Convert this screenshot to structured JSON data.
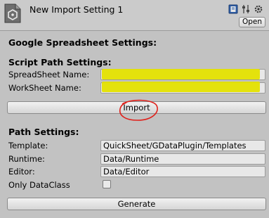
{
  "header": {
    "title": "New Import Setting 1",
    "open_label": "Open",
    "icons": [
      "help-book-icon",
      "settings-sliders-icon",
      "gear-icon"
    ]
  },
  "google_section": {
    "title": "Google Spreadsheet Settings:"
  },
  "script_path": {
    "title": "Script Path Settings:",
    "spreadsheet_label": "SpreadSheet Name:",
    "spreadsheet_value": "",
    "worksheet_label": "WorkSheet Name:",
    "worksheet_value": ""
  },
  "import_label": "Import",
  "path_settings": {
    "title": "Path Settings:",
    "template_label": "Template:",
    "template_value": "QuickSheet/GDataPlugin/Templates",
    "runtime_label": "Runtime:",
    "runtime_value": "Data/Runtime",
    "editor_label": "Editor:",
    "editor_value": "Data/Editor",
    "only_dataclass_label": "Only DataClass",
    "only_dataclass_checked": false
  },
  "generate_label": "Generate",
  "colors": {
    "highlight": "#e4e200",
    "annotation_red": "#e0201a"
  }
}
